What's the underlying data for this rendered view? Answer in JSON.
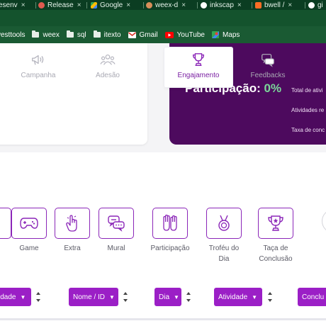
{
  "browser": {
    "tabs": [
      {
        "title": "esenv",
        "favicon": "generic-tab-icon",
        "color": "#7aa58b"
      },
      {
        "title": "Release",
        "favicon": "headset-icon",
        "color": "#e05a4f"
      },
      {
        "title": "Google",
        "favicon": "google-drive-icon",
        "color": "#f4c542"
      },
      {
        "title": "weex-d",
        "favicon": "avatar-icon",
        "color": "#d98e5a"
      },
      {
        "title": "inkscap",
        "favicon": "google-icon",
        "color": "#ffffff"
      },
      {
        "title": "bwell /",
        "favicon": "gitlab-icon",
        "color": "#fc6d26"
      },
      {
        "title": "gi",
        "favicon": "google-icon",
        "color": "#ffffff"
      }
    ],
    "close_glyph": "×",
    "bookmarks": [
      {
        "label": "vesttools",
        "icon": "none"
      },
      {
        "label": "weex",
        "icon": "folder-icon"
      },
      {
        "label": "sql",
        "icon": "folder-icon"
      },
      {
        "label": "itexto",
        "icon": "folder-icon"
      },
      {
        "label": "Gmail",
        "icon": "gmail-icon"
      },
      {
        "label": "YouTube",
        "icon": "youtube-icon"
      },
      {
        "label": "Maps",
        "icon": "maps-icon"
      }
    ]
  },
  "summary": {
    "participation_label": "Participação:",
    "participation_value": "0%",
    "stats": [
      "Total de ativi",
      "Atividades re",
      "Taxa de conc"
    ]
  },
  "nav_tabs": [
    {
      "label": "Campanha",
      "icon": "megaphone-icon",
      "active": false
    },
    {
      "label": "Adesão",
      "icon": "people-icon",
      "active": false
    },
    {
      "label": "Engajamento",
      "icon": "trophy-icon",
      "active": true
    },
    {
      "label": "Feedbacks",
      "icon": "chat-icon",
      "active": false
    }
  ],
  "filters": [
    {
      "label": "Game",
      "icon": "gamepad-icon"
    },
    {
      "label": "Extra",
      "icon": "pointer-hand-icon"
    },
    {
      "label": "Mural",
      "icon": "chat-bubbles-icon"
    },
    {
      "label": "Participação",
      "icon": "raised-hands-icon"
    },
    {
      "label": "Troféu do Dia",
      "line1": "Troféu do",
      "line2": "Dia",
      "icon": "medal-icon"
    },
    {
      "label": "Taça de Conclusão",
      "line1": "Taça de",
      "line2": "Conclusão",
      "icon": "trophy-star-icon"
    }
  ],
  "sort_fields": [
    {
      "label": "idade"
    },
    {
      "label": "Nome / ID"
    },
    {
      "label": "Dia"
    },
    {
      "label": "Atividade"
    },
    {
      "label": "Conclu"
    }
  ],
  "colors": {
    "accent": "#9b1fc6",
    "summary_bg": "#4d0a5e",
    "browser_green": "#14532d"
  }
}
